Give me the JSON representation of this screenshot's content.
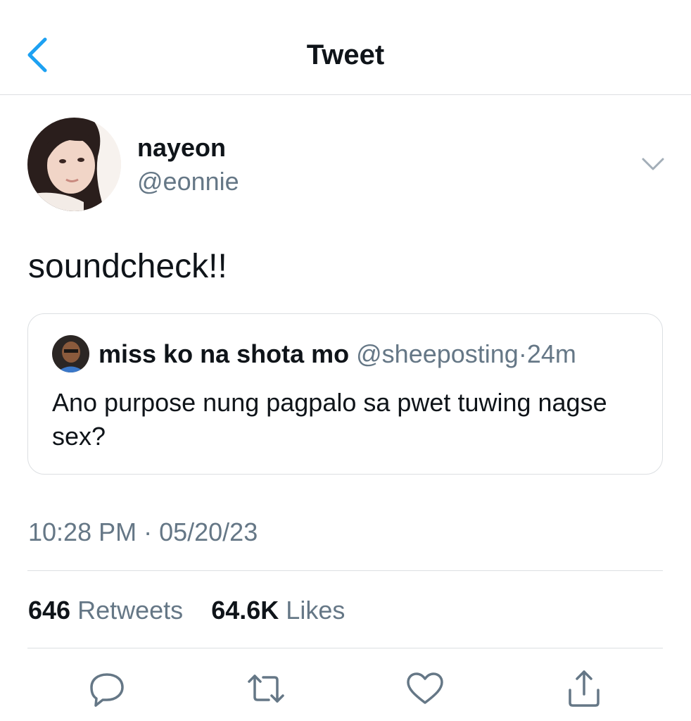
{
  "header": {
    "title": "Tweet"
  },
  "author": {
    "name": "nayeon",
    "handle": "@eonnie"
  },
  "tweet": {
    "text": "soundcheck!!"
  },
  "quote": {
    "name": "miss ko na shota mo",
    "handle": "@sheeposting",
    "separator": "·",
    "time": "24m",
    "text": "Ano purpose nung pagpalo sa pwet tuwing nagse sex?"
  },
  "meta": {
    "timestamp": "10:28 PM · 05/20/23"
  },
  "stats": {
    "retweets_count": "646",
    "retweets_label": "Retweets",
    "likes_count": "64.6K",
    "likes_label": "Likes"
  },
  "icons": {
    "back": "chevron-left-icon",
    "more": "chevron-down-icon",
    "reply": "reply-icon",
    "retweet": "retweet-icon",
    "like": "heart-icon",
    "share": "share-icon"
  },
  "colors": {
    "accent": "#1da1f2",
    "text": "#0f1419",
    "secondary": "#657786",
    "border": "#dcdfe2"
  }
}
